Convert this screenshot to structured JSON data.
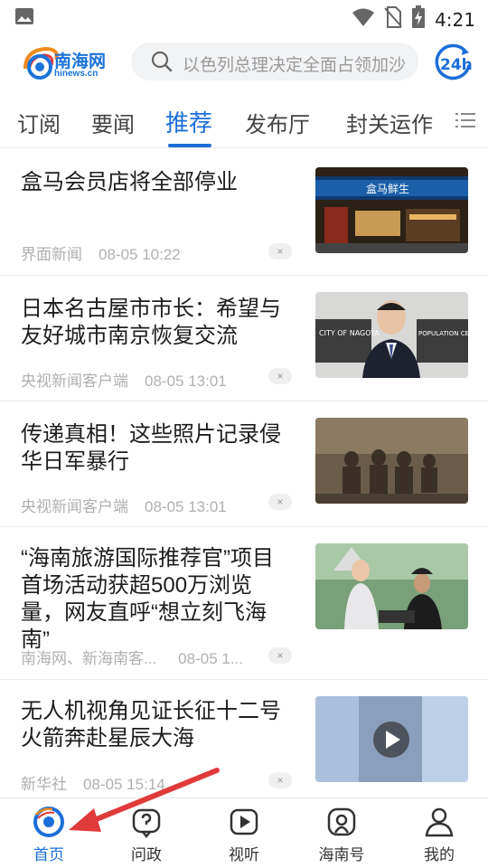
{
  "status_bar": {
    "time": "4:21"
  },
  "header": {
    "logo_name": "南海网",
    "logo_domain": "hinews.cn",
    "search_placeholder": "以色列总理决定全面占领加沙",
    "badge_24h": "24h"
  },
  "tabs": [
    "订阅",
    "要闻",
    "推荐",
    "发布厅",
    "封关运作"
  ],
  "active_tab": "推荐",
  "news": [
    {
      "title": "盒马会员店将全部停业",
      "source": "界面新闻",
      "time": "08-05 10:22",
      "thumb_sign": "盒马鲜生"
    },
    {
      "title": "日本名古屋市市长：希望与友好城市南京恢复交流",
      "source": "央视新闻客户端",
      "time": "08-05 13:01",
      "thumb_sign_left": "CITY OF NAGOYA",
      "thumb_sign_right": "POPULATION CENSUS"
    },
    {
      "title": "传递真相！这些照片记录侵华日军暴行",
      "source": "央视新闻客户端",
      "time": "08-05 13:01"
    },
    {
      "title": "“海南旅游国际推荐官”项目首场活动获超500万浏览量，网友直呼“想立刻飞海南”",
      "source": "南海网、新海南客...",
      "time": "08-05 1..."
    },
    {
      "title": "无人机视角见证长征十二号火箭奔赴星辰大海",
      "source": "新华社",
      "time": "08-05 15:14"
    }
  ],
  "close_symbol": "×",
  "bottom_nav": [
    "首页",
    "问政",
    "视听",
    "海南号",
    "我的"
  ],
  "colors": {
    "accent": "#1c6fd8",
    "arrow": "#e03a3a"
  }
}
